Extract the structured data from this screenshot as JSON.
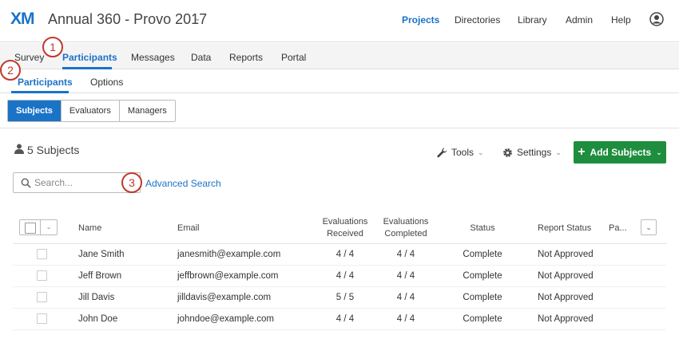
{
  "header": {
    "logo_x": "X",
    "logo_m": "M",
    "project_title": "Annual 360 - Provo 2017",
    "nav": [
      {
        "label": "Projects",
        "active": true
      },
      {
        "label": "Directories",
        "active": false
      },
      {
        "label": "Library",
        "active": false
      },
      {
        "label": "Admin",
        "active": false
      },
      {
        "label": "Help",
        "active": false
      }
    ]
  },
  "tabs": [
    {
      "label": "Survey",
      "active": false
    },
    {
      "label": "Participants",
      "active": true
    },
    {
      "label": "Messages",
      "active": false
    },
    {
      "label": "Data",
      "active": false
    },
    {
      "label": "Reports",
      "active": false
    },
    {
      "label": "Portal",
      "active": false
    }
  ],
  "subtabs": [
    {
      "label": "Participants",
      "active": true
    },
    {
      "label": "Options",
      "active": false
    }
  ],
  "segments": [
    {
      "label": "Subjects",
      "active": true
    },
    {
      "label": "Evaluators",
      "active": false
    },
    {
      "label": "Managers",
      "active": false
    }
  ],
  "toolbar": {
    "subject_count": "5 Subjects",
    "tools_label": "Tools",
    "settings_label": "Settings",
    "add_label": "Add Subjects"
  },
  "search": {
    "placeholder": "Search...",
    "advanced_label": "Advanced Search"
  },
  "annotations": [
    "1",
    "2",
    "3"
  ],
  "table": {
    "columns": {
      "name": "Name",
      "email": "Email",
      "eval_received_1": "Evaluations",
      "eval_received_2": "Received",
      "eval_completed_1": "Evaluations",
      "eval_completed_2": "Completed",
      "status": "Status",
      "report_status": "Report Status",
      "truncated": "Pa..."
    },
    "rows": [
      {
        "name": "Jane Smith",
        "email": "janesmith@example.com",
        "received": "4 / 4",
        "completed": "4 / 4",
        "status": "Complete",
        "report": "Not Approved"
      },
      {
        "name": "Jeff Brown",
        "email": "jeffbrown@example.com",
        "received": "4 / 4",
        "completed": "4 / 4",
        "status": "Complete",
        "report": "Not Approved"
      },
      {
        "name": "Jill Davis",
        "email": "jilldavis@example.com",
        "received": "5 / 5",
        "completed": "4 / 4",
        "status": "Complete",
        "report": "Not Approved"
      },
      {
        "name": "John Doe",
        "email": "johndoe@example.com",
        "received": "4 / 4",
        "completed": "4 / 4",
        "status": "Complete",
        "report": "Not Approved"
      }
    ]
  },
  "colors": {
    "accent": "#1a73c7",
    "add_button": "#1e8e3e",
    "annotation": "#c0392b"
  }
}
